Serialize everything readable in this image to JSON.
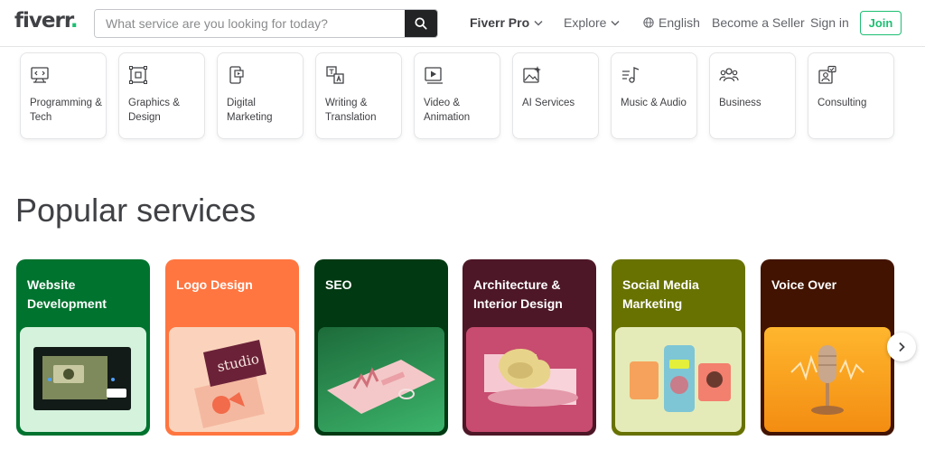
{
  "header": {
    "logo_text": "fiverr",
    "logo_dot": ".",
    "search_placeholder": "What service are you looking for today?",
    "nav": {
      "pro": "Fiverr Pro",
      "explore": "Explore",
      "language": "English",
      "become_seller": "Become a Seller",
      "sign_in": "Sign in",
      "join": "Join"
    }
  },
  "categories": [
    {
      "label": "Programming & Tech",
      "icon": "monitor-code-icon"
    },
    {
      "label": "Graphics & Design",
      "icon": "vector-frame-icon"
    },
    {
      "label": "Digital Marketing",
      "icon": "phone-chart-icon"
    },
    {
      "label": "Writing & Translation",
      "icon": "translation-icon"
    },
    {
      "label": "Video & Animation",
      "icon": "video-play-icon"
    },
    {
      "label": "AI Services",
      "icon": "ai-image-icon"
    },
    {
      "label": "Music & Audio",
      "icon": "music-note-icon"
    },
    {
      "label": "Business",
      "icon": "people-icon"
    },
    {
      "label": "Consulting",
      "icon": "consulting-icon"
    }
  ],
  "popular": {
    "title": "Popular services",
    "cards": [
      {
        "title": "Website Development",
        "color": "#00732e",
        "icon": "website-mockup-image"
      },
      {
        "title": "Logo Design",
        "color": "#ff7640",
        "icon": "business-card-image"
      },
      {
        "title": "SEO",
        "color": "#003912",
        "icon": "seo-chart-image"
      },
      {
        "title": "Architecture & Interior Design",
        "color": "#4d1727",
        "icon": "furniture-image"
      },
      {
        "title": "Social Media Marketing",
        "color": "#687200",
        "icon": "social-phone-image"
      },
      {
        "title": "Voice Over",
        "color": "#421300",
        "icon": "microphone-image"
      }
    ]
  },
  "colors": {
    "brand_green": "#1dbf73",
    "text_dark": "#404145"
  }
}
